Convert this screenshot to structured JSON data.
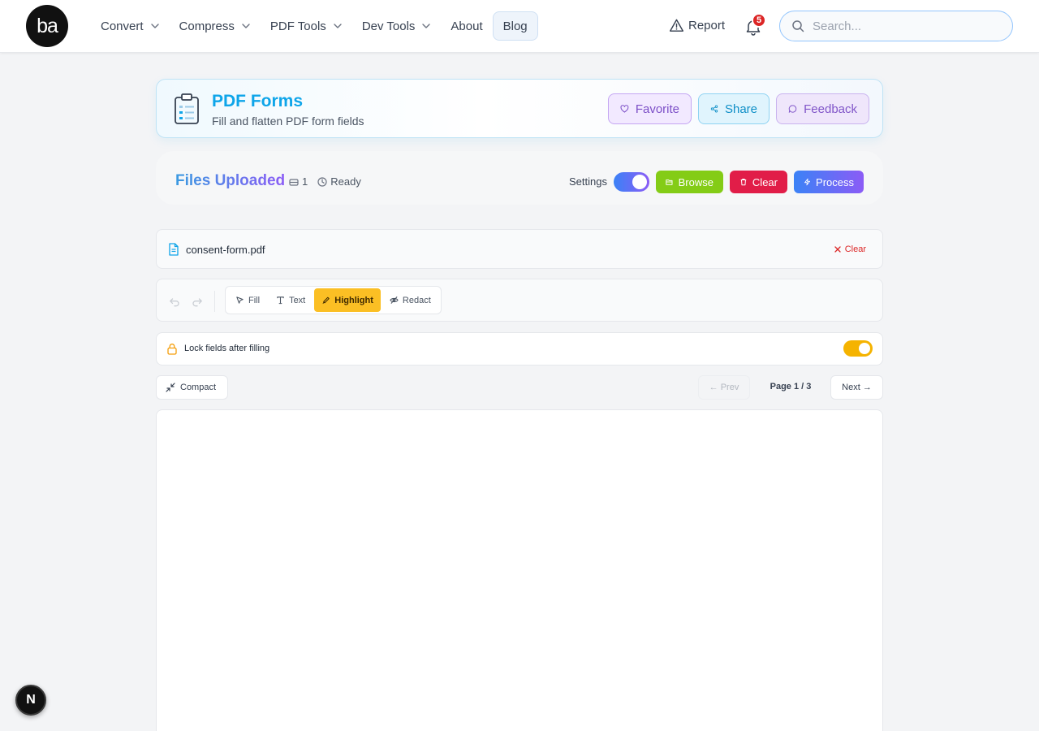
{
  "header": {
    "logo_text": "ba",
    "nav": [
      {
        "label": "Convert",
        "dropdown": true
      },
      {
        "label": "Compress",
        "dropdown": true
      },
      {
        "label": "PDF Tools",
        "dropdown": true
      },
      {
        "label": "Dev Tools",
        "dropdown": true
      },
      {
        "label": "About",
        "dropdown": false
      },
      {
        "label": "Blog",
        "dropdown": false,
        "active": true
      }
    ],
    "report_label": "Report",
    "notification_count": "5",
    "search_placeholder": "Search..."
  },
  "tool_header": {
    "title": "PDF Forms",
    "subtitle": "Fill and flatten PDF form fields",
    "favorite_label": "Favorite",
    "share_label": "Share",
    "feedback_label": "Feedback"
  },
  "files_bar": {
    "title": "Files Uploaded",
    "file_count": "1",
    "status": "Ready",
    "settings_label": "Settings",
    "settings_enabled": true,
    "browse_label": "Browse",
    "clear_label": "Clear",
    "process_label": "Process"
  },
  "file": {
    "name": "consent-form.pdf",
    "clear_label": "Clear"
  },
  "toolbar": {
    "tools": [
      {
        "label": "Fill",
        "icon": "pointer-icon",
        "active": false
      },
      {
        "label": "Text",
        "icon": "text-icon",
        "active": false
      },
      {
        "label": "Highlight",
        "icon": "highlighter-icon",
        "active": true
      },
      {
        "label": "Redact",
        "icon": "eye-off-icon",
        "active": false
      }
    ]
  },
  "lock": {
    "label": "Lock fields after filling",
    "enabled": true
  },
  "pager": {
    "compact_label": "Compact",
    "prev_label": "← Prev",
    "page_info": "Page 1 / 3",
    "next_label": "Next →"
  },
  "dev_badge": "N",
  "colors": {
    "accent_blue": "#0ea5e9",
    "highlight_active": "#fbbf24",
    "browse_green": "#84cc16",
    "clear_red": "#e11d48",
    "lock_toggle": "#f5b300"
  }
}
